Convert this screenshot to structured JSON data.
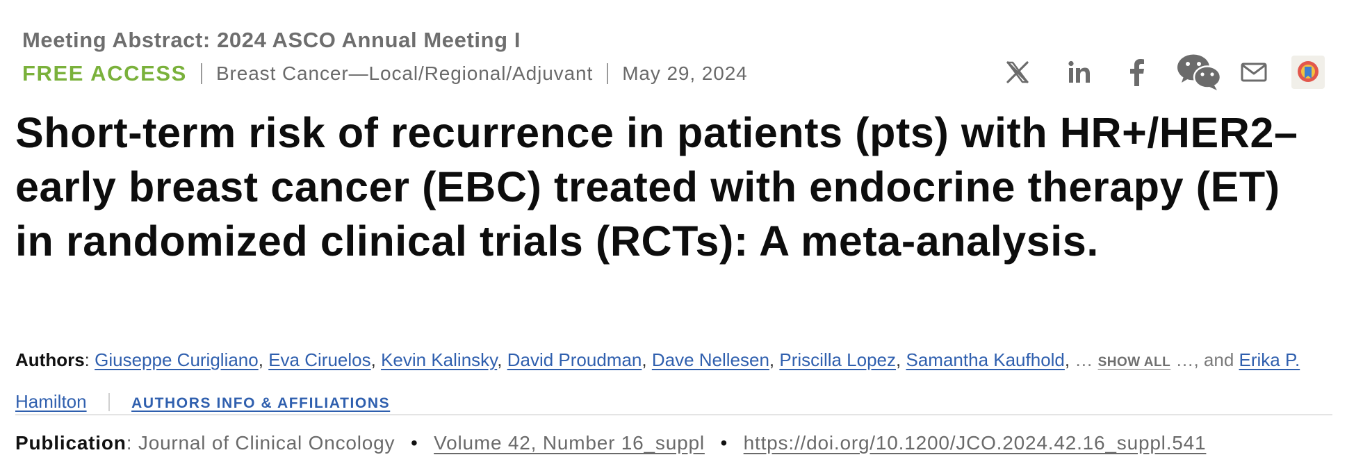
{
  "header": {
    "meeting": "Meeting Abstract: 2024 ASCO Annual Meeting I",
    "access": "FREE ACCESS",
    "category": "Breast Cancer—Local/Regional/Adjuvant",
    "date": "May 29, 2024"
  },
  "share": {
    "icons": [
      "x-icon",
      "linkedin-icon",
      "facebook-icon",
      "wechat-icon",
      "email-icon",
      "mendeley-icon"
    ]
  },
  "article": {
    "title": "Short-term risk of recurrence in patients (pts) with HR+/HER2– early breast cancer (EBC) treated with endocrine therapy (ET) in randomized clinical trials (RCTs): A meta-analysis."
  },
  "authors": {
    "label": "Authors",
    "colon": ":",
    "list": [
      "Giuseppe Curigliano",
      "Eva Ciruelos",
      "Kevin Kalinsky",
      "David Proudman",
      "Dave Nellesen",
      "Priscilla Lopez",
      "Samantha Kaufhold"
    ],
    "comma": ",",
    "ellipsis": "…",
    "show_all": "SHOW ALL",
    "and_text": "…, and",
    "last_author": "Erika P. Hamilton",
    "affiliations_link": "AUTHORS INFO & AFFILIATIONS"
  },
  "publication": {
    "label": "Publication",
    "colon": ":",
    "journal": "Journal of Clinical Oncology",
    "bullet": "•",
    "volume": "Volume 42, Number 16_suppl",
    "doi": "https://doi.org/10.1200/JCO.2024.42.16_suppl.541"
  }
}
